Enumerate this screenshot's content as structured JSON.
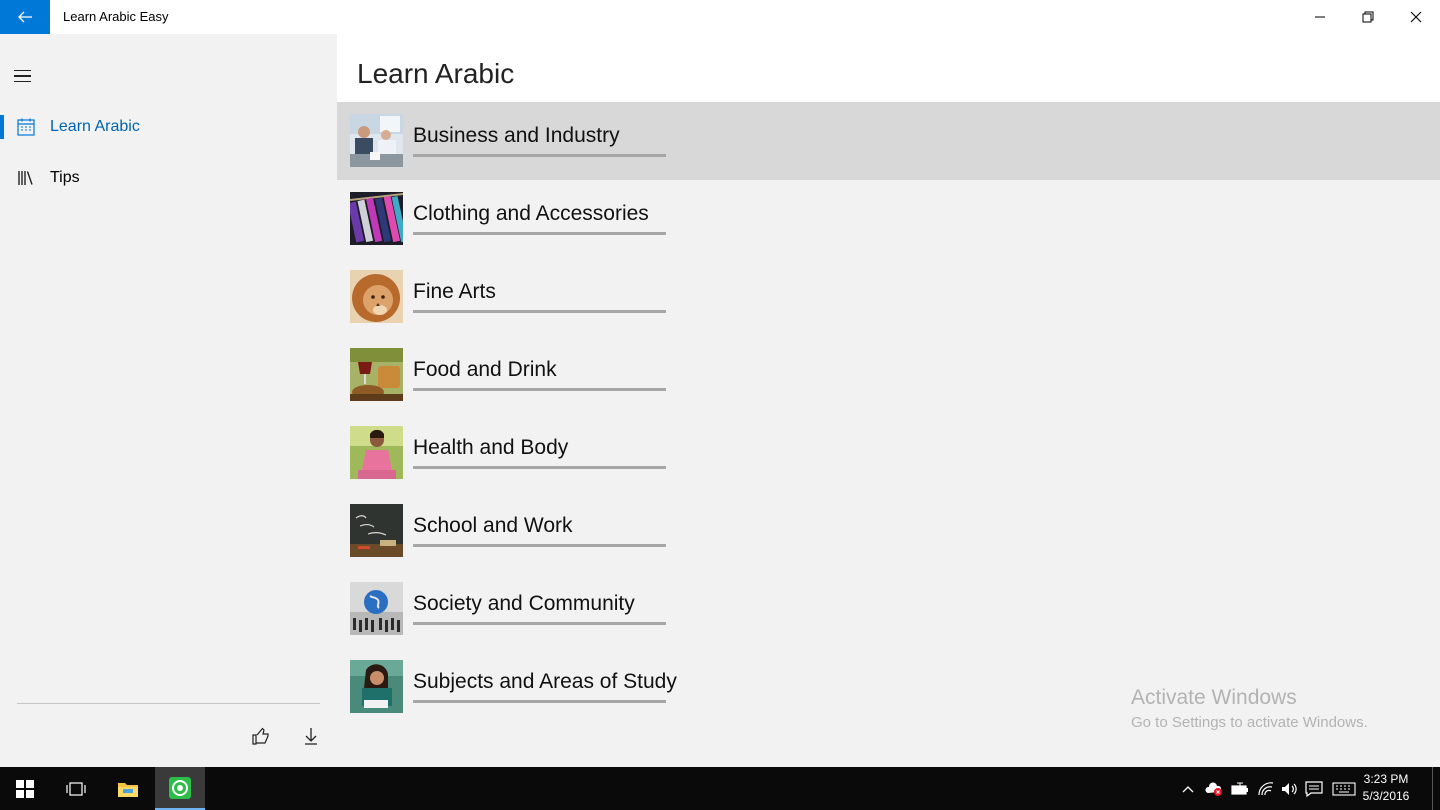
{
  "window": {
    "title": "Learn Arabic Easy",
    "accent_color": "#0078d7"
  },
  "sidebar": {
    "items": [
      {
        "label": "Learn Arabic",
        "icon": "calendar-icon",
        "selected": true
      },
      {
        "label": "Tips",
        "icon": "library-books-icon",
        "selected": false
      }
    ],
    "footer": {
      "like_icon": "thumbs-up-icon",
      "download_icon": "download-icon"
    }
  },
  "main": {
    "title": "Learn Arabic",
    "categories": [
      {
        "label": "Business and Industry",
        "thumb": "business-meeting-photo",
        "selected": true
      },
      {
        "label": "Clothing and Accessories",
        "thumb": "clothes-hangers-photo",
        "selected": false
      },
      {
        "label": "Fine Arts",
        "thumb": "lion-painting-photo",
        "selected": false
      },
      {
        "label": "Food and Drink",
        "thumb": "wine-and-bread-photo",
        "selected": false
      },
      {
        "label": "Health and Body",
        "thumb": "woman-on-grass-photo",
        "selected": false
      },
      {
        "label": "School and Work",
        "thumb": "back-to-school-chalkboard-photo",
        "selected": false
      },
      {
        "label": "Society and Community",
        "thumb": "globe-with-people-photo",
        "selected": false
      },
      {
        "label": "Subjects and Areas of Study",
        "thumb": "student-writing-photo",
        "selected": false
      }
    ]
  },
  "watermark": {
    "title": "Activate Windows",
    "subtitle": "Go to Settings to activate Windows."
  },
  "taskbar": {
    "time": "3:23 PM",
    "date": "5/3/2016",
    "tray_icons": [
      "chevron-up-icon",
      "onedrive-error-icon",
      "battery-icon",
      "wifi-icon",
      "volume-icon",
      "action-center-icon",
      "keyboard-icon"
    ]
  }
}
